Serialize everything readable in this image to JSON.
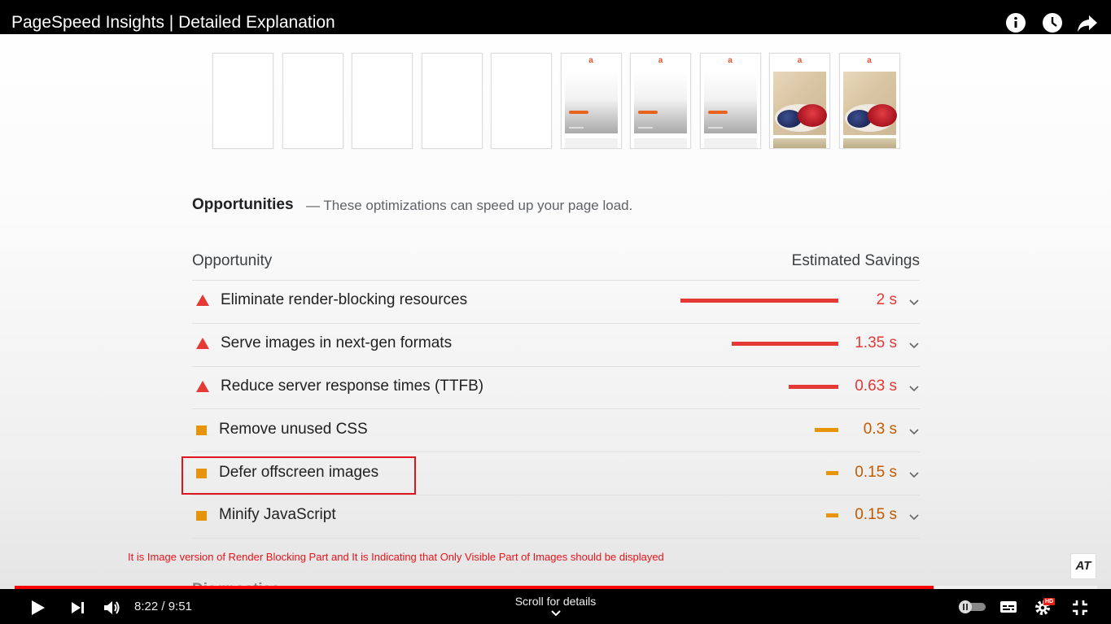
{
  "video": {
    "title": "PageSpeed Insights | Detailed Explanation",
    "icons": [
      "info-icon",
      "clock-icon",
      "share-icon"
    ]
  },
  "filmstrip": {
    "frame_logo": "a",
    "frames": [
      "blank",
      "blank",
      "blank",
      "blank",
      "blank",
      "loading",
      "loading",
      "loading",
      "photo",
      "photo"
    ]
  },
  "opportunities": {
    "title": "Opportunities",
    "subtitle": "— These optimizations can speed up your page load.",
    "col_opportunity": "Opportunity",
    "col_savings": "Estimated Savings",
    "rows": [
      {
        "label": "Eliminate render-blocking resources",
        "savings": "2 s",
        "seconds": 2,
        "severity": "fail"
      },
      {
        "label": "Serve images in next-gen formats",
        "savings": "1.35 s",
        "seconds": 1.35,
        "severity": "fail"
      },
      {
        "label": "Reduce server response times (TTFB)",
        "savings": "0.63 s",
        "seconds": 0.63,
        "severity": "fail"
      },
      {
        "label": "Remove unused CSS",
        "savings": "0.3 s",
        "seconds": 0.3,
        "severity": "average"
      },
      {
        "label": "Defer offscreen images",
        "savings": "0.15 s",
        "seconds": 0.15,
        "severity": "average"
      },
      {
        "label": "Minify JavaScript",
        "savings": "0.15 s",
        "seconds": 0.15,
        "severity": "average"
      }
    ],
    "colors": {
      "fail": "#e53935",
      "fail_text": "#e53935",
      "average": "#e8940a",
      "average_text": "#c45a00"
    }
  },
  "annotation": {
    "caption": "It is Image version of Render Blocking Part and It is Indicating that Only Visible Part of Images should be displayed",
    "next_section": "Diagnostics",
    "channel_logo": "AT"
  },
  "player": {
    "current_time": "8:22",
    "duration": "9:51",
    "time_display": "8:22 / 9:51",
    "progress": 0.849,
    "scroll_hint": "Scroll for details",
    "hd_badge": "HD",
    "accent": "#ff0000"
  }
}
